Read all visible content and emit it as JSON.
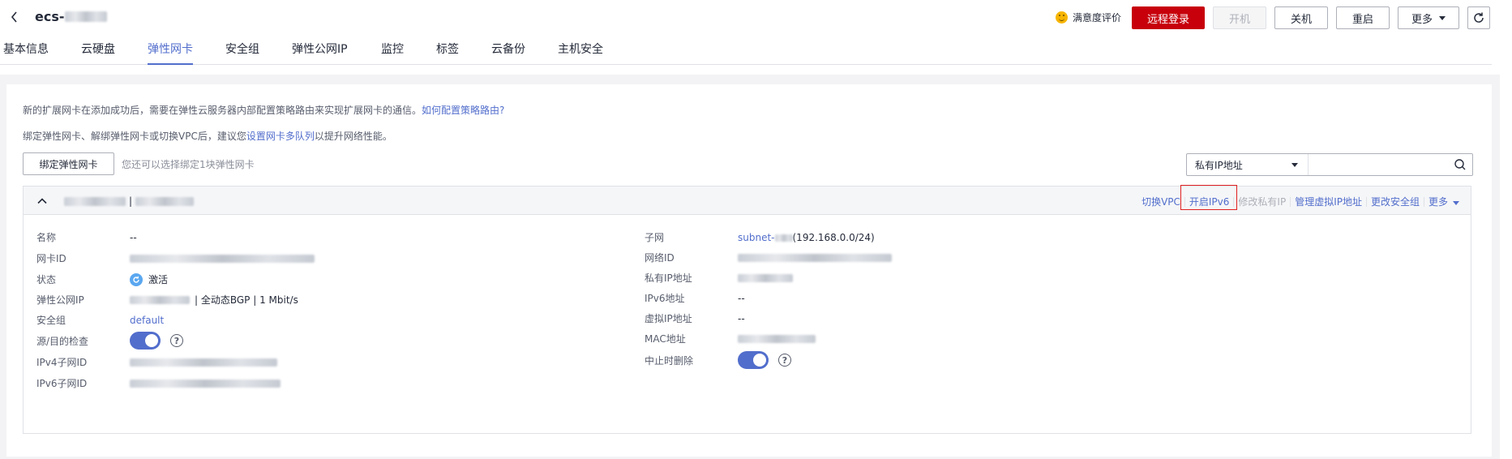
{
  "header": {
    "ecs_name_prefix": "ecs-",
    "satisfaction": "满意度评价",
    "buttons": {
      "remote_login": "远程登录",
      "start": "开机",
      "stop": "关机",
      "restart": "重启",
      "more": "更多"
    }
  },
  "tabs": [
    "基本信息",
    "云硬盘",
    "弹性网卡",
    "安全组",
    "弹性公网IP",
    "监控",
    "标签",
    "云备份",
    "主机安全"
  ],
  "active_tab": "弹性网卡",
  "notes": {
    "line1_text": "新的扩展网卡在添加成功后，需要在弹性云服务器内部配置策略路由来实现扩展网卡的通信。",
    "line1_link": "如何配置策略路由?",
    "line2_prefix": "绑定弹性网卡、解绑弹性网卡或切换VPC后，建议您",
    "line2_link": "设置网卡多队列",
    "line2_suffix": "以提升网络性能。"
  },
  "toolbar": {
    "bind_button": "绑定弹性网卡",
    "bind_hint": "您还可以选择绑定1块弹性网卡",
    "search_select": "私有IP地址",
    "search_placeholder": ""
  },
  "nic": {
    "title_separator": "|",
    "ops": [
      "切换VPC",
      "开启IPv6",
      "修改私有IP",
      "管理虚拟IP地址",
      "更改安全组",
      "更多"
    ],
    "highlighted_op": "开启IPv6",
    "left": {
      "name_label": "名称",
      "name_value": "--",
      "nic_id_label": "网卡ID",
      "status_label": "状态",
      "status_value": "激活",
      "eip_label": "弹性公网IP",
      "eip_suffix": "| 全动态BGP | 1 Mbit/s",
      "sg_label": "安全组",
      "sg_value": "default",
      "src_dst_label": "源/目的检查",
      "ipv4_subnet_label": "IPv4子网ID",
      "ipv6_subnet_label": "IPv6子网ID"
    },
    "right": {
      "subnet_label": "子网",
      "subnet_prefix": "subnet-",
      "subnet_cidr": "(192.168.0.0/24)",
      "network_id_label": "网络ID",
      "private_ip_label": "私有IP地址",
      "ipv6_label": "IPv6地址",
      "ipv6_value": "--",
      "vip_label": "虚拟IP地址",
      "vip_value": "--",
      "mac_label": "MAC地址",
      "delete_on_term_label": "中止时删除"
    },
    "toggles": {
      "src_dst_check": true,
      "delete_on_termination": true
    }
  },
  "colors": {
    "brand_red": "#c7000b",
    "link_blue": "#526ecc",
    "highlight_red": "#e02020",
    "status_blue": "#5aa7f0"
  }
}
